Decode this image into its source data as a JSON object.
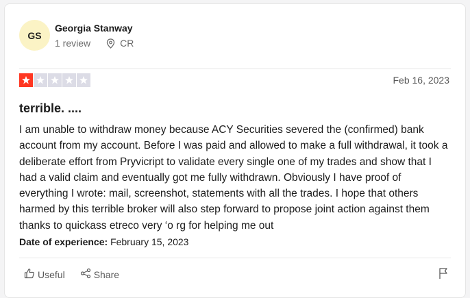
{
  "reviewer": {
    "initials": "GS",
    "name": "Georgia Stanway",
    "review_count": "1 review",
    "country": "CR"
  },
  "review": {
    "rating": 1,
    "max_rating": 5,
    "date": "Feb 16, 2023",
    "title": "terrible. ....",
    "body": "I am unable to withdraw money because ACY Securities severed the (confirmed) bank account from my account. Before I was paid and allowed to make a full withdrawal, it took a deliberate effort from Pryvicript to validate every single one of my trades and show that I had a valid claim and eventually got me fully withdrawn. Obviously I have proof of everything I wrote: mail, screenshot, statements with all the trades. I hope that others harmed by this terrible broker will also step forward to propose joint action against them thanks to quickass etreco very ‘o rg for helping me out",
    "experience_label": "Date of experience:",
    "experience_date": "February 15, 2023"
  },
  "actions": {
    "useful_label": "Useful",
    "share_label": "Share"
  },
  "colors": {
    "star_filled": "#ff3722",
    "star_empty": "#dcdce6",
    "avatar_bg": "#fbf3c5"
  },
  "icons": [
    "location-pin-icon",
    "star-icon",
    "thumbs-up-icon",
    "share-icon",
    "flag-icon"
  ]
}
